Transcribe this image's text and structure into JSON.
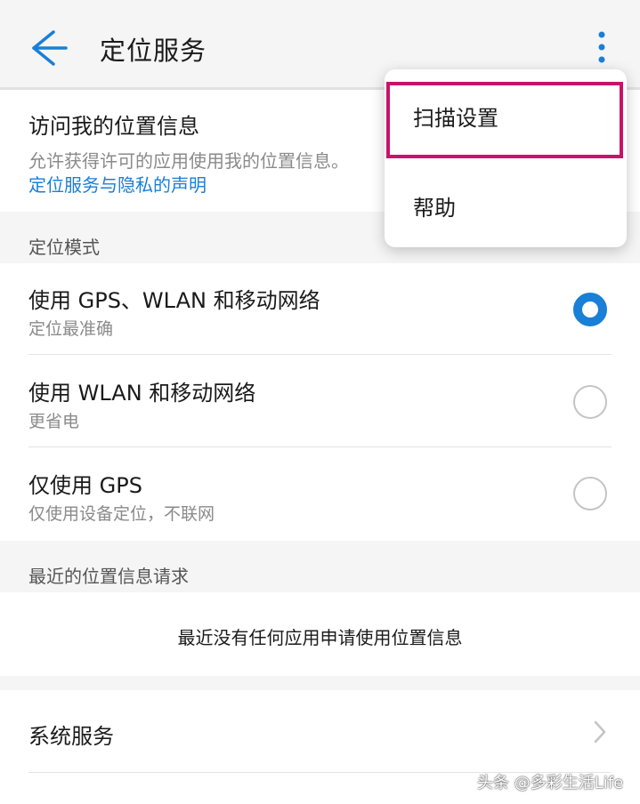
{
  "header": {
    "title": "定位服务",
    "back_icon": "arrow-left-icon",
    "more_icon": "more-vertical-icon"
  },
  "access": {
    "title": "访问我的位置信息",
    "description": "允许获得许可的应用使用我的位置信息。",
    "privacy_link": "定位服务与隐私的声明"
  },
  "mode_section": {
    "header": "定位模式",
    "options": [
      {
        "title": "使用 GPS、WLAN 和移动网络",
        "subtitle": "定位最准确",
        "selected": true
      },
      {
        "title": "使用 WLAN 和移动网络",
        "subtitle": "更省电",
        "selected": false
      },
      {
        "title": "仅使用 GPS",
        "subtitle": "仅使用设备定位，不联网",
        "selected": false
      }
    ]
  },
  "recent_section": {
    "header": "最近的位置信息请求",
    "empty_text": "最近没有任何应用申请使用位置信息"
  },
  "system": {
    "label": "系统服务",
    "chevron_icon": "chevron-right-icon"
  },
  "menu": {
    "items": [
      "扫描设置",
      "帮助"
    ],
    "highlighted_item": "扫描设置",
    "highlight_color": "#c8126c"
  },
  "watermark": "头条 @多彩生活Life",
  "colors": {
    "accent": "#1a7fd6",
    "background": "#f5f5f5"
  }
}
